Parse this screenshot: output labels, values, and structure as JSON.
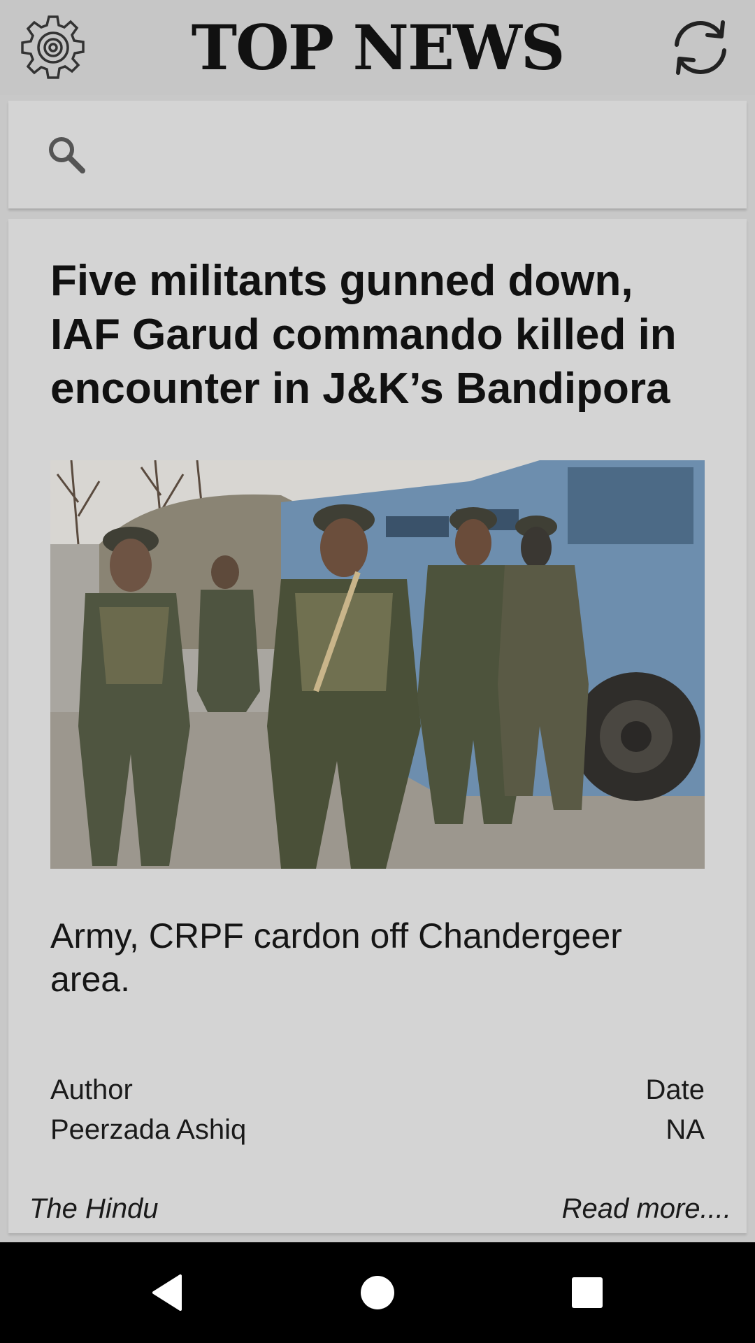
{
  "header": {
    "title": "TOP NEWS",
    "settings_icon": "gear-icon",
    "refresh_icon": "refresh-icon"
  },
  "search": {
    "icon": "search-icon",
    "value": ""
  },
  "article": {
    "headline": "Five militants gunned down, IAF Garud commando killed in encounter in J&K’s Bandipora",
    "image_alt": "soldiers-near-armored-vehicles",
    "description": "Army, CRPF cardon off Chandergeer area.",
    "author_label": "Author",
    "author": "Peerzada Ashiq",
    "date_label": "Date",
    "date": "NA",
    "source": "The Hindu",
    "read_more": "Read more...."
  },
  "nav": {
    "back_icon": "back-triangle-icon",
    "home_icon": "home-circle-icon",
    "recents_icon": "recents-square-icon"
  }
}
